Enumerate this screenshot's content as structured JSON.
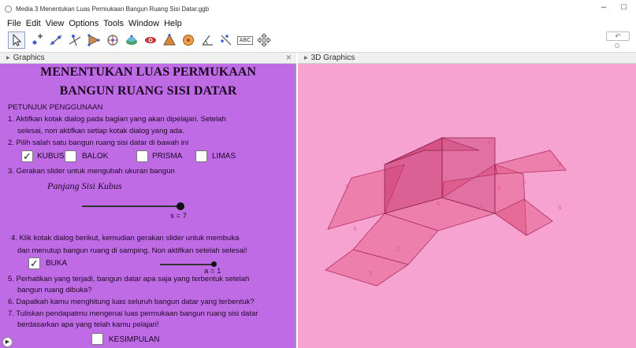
{
  "window": {
    "title": "Media 3 Menentukan Luas Permukaan Bangun Ruang Sisi Datar.ggb",
    "minimize": "–",
    "restore": "□"
  },
  "menu": [
    "File",
    "Edit",
    "View",
    "Options",
    "Tools",
    "Window",
    "Help"
  ],
  "toolbar": {
    "tools": [
      "move-icon",
      "point-icon",
      "line-icon",
      "perpendicular-icon",
      "polygon-icon",
      "circle-icon",
      "pyramid-icon",
      "sphere-icon",
      "prism-icon",
      "cone-icon",
      "angle-icon",
      "reflect-icon",
      "text-icon",
      "move-view-icon"
    ],
    "text_tool_label": "ABC",
    "undo_label": "↶"
  },
  "graphics": {
    "header": "Graphics",
    "close": "✕",
    "title_line1": "MENENTUKAN LUAS PERMUKAAN",
    "title_line2": "BANGUN RUANG SISI DATAR",
    "instructions_heading": "PETUNJUK PENGGUNAAN",
    "step1a": "1. Aktifkan kotak dialog pada bagian yang akan dipelajari. Setelah",
    "step1b": "selesai, non aktifkan setiap kotak dialog yang ada.",
    "step2": "2. Pilih salah satu bangun ruang sisi datar di bawah ini",
    "shapes": [
      {
        "label": "KUBUS",
        "checked": true
      },
      {
        "label": "BALOK",
        "checked": false
      },
      {
        "label": "PRISMA",
        "checked": false
      },
      {
        "label": "LIMAS",
        "checked": false
      }
    ],
    "step3": "3. Gerakan slider untuk mengubah ukuran bangun",
    "slider_label": "Panjang Sisi Kubus",
    "slider_s_value": "s = 7",
    "slider_s_fraction": 1.0,
    "step4a": "4. Klik kotak dialog berikut, kemudian gerakan slider untuk membuka",
    "step4b": "dan menutup bangun ruang di samping. Non aktifkan setelah selesai!",
    "buka_label": "BUKA",
    "buka_checked": true,
    "slider_a_value": "a = 1",
    "slider_a_fraction": 1.0,
    "step5a": "5. Perhatikan yang terjadi, bangun datar apa saja yang terbentuk setelah",
    "step5b": "bangun ruang dibuka?",
    "step6": "6. Dapatkah kamu menghitung luas seluruh bangun datar yang terbentuk?",
    "step7a": "7. Tuliskan pendapatmu mengenai luas permukaan bangun ruang sisi datar",
    "step7b": "berdasarkan apa yang telah kamu pelajari!",
    "kesimpulan_label": "KESIMPULAN",
    "kesimpulan_checked": false
  },
  "graphics3d": {
    "header": "3D Graphics",
    "face_label": "S",
    "colors": {
      "background": "#f7a3d2",
      "face_fill": "#e0557f",
      "face_stroke": "#b03060"
    }
  },
  "colors": {
    "graphics_bg": "#c06be6",
    "g3d_bg": "#f7a3d2"
  }
}
